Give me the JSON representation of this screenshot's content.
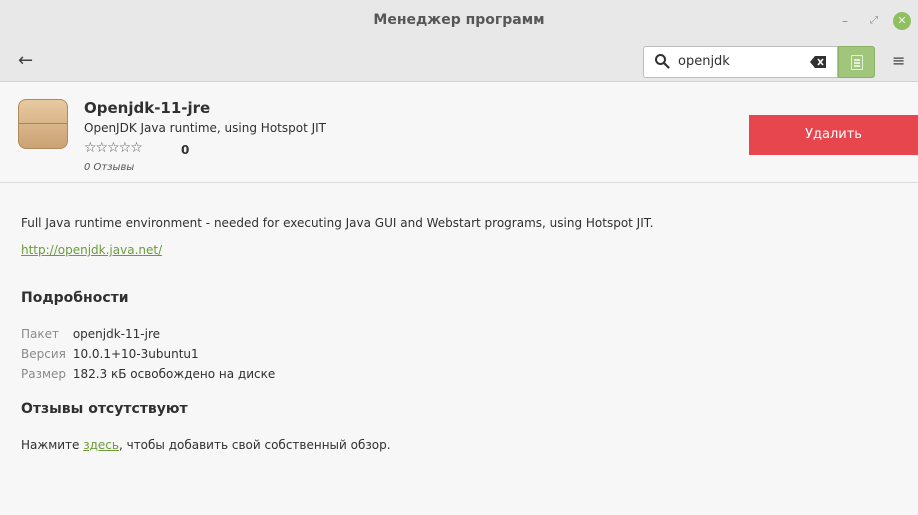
{
  "window": {
    "title": "Менеджер программ",
    "controls": {
      "minimize": "–",
      "maximize": "⤢",
      "close": "✕"
    },
    "close_color": "#8fbf5f"
  },
  "header": {
    "back_icon": "←",
    "search_value": "openjdk",
    "view_button_color": "#9fc67a",
    "menu_icon": "≡"
  },
  "app": {
    "name": "Openjdk-11-jre",
    "summary": "OpenJDK Java runtime, using Hotspot JIT",
    "stars": "☆☆☆☆☆",
    "rating": "0",
    "reviews_count": "0 Отзывы",
    "remove_label": "Удалить",
    "remove_color": "#e8464e"
  },
  "body": {
    "description": "Full Java runtime environment - needed for executing Java GUI and Webstart programs, using Hotspot JIT.",
    "homepage": "http://openjdk.java.net/",
    "details_heading": "Подробности",
    "details": [
      {
        "key": "Пакет",
        "value": "openjdk-11-jre"
      },
      {
        "key": "Версия",
        "value": "10.0.1+10-3ubuntu1"
      },
      {
        "key": "Размер",
        "value": "182.3 кБ освобождено на диске"
      }
    ],
    "reviews_heading": "Отзывы отсутствуют",
    "review_prompt_before": "Нажмите ",
    "review_prompt_link": "здесь",
    "review_prompt_after": ", чтобы добавить свой собственный обзор."
  }
}
